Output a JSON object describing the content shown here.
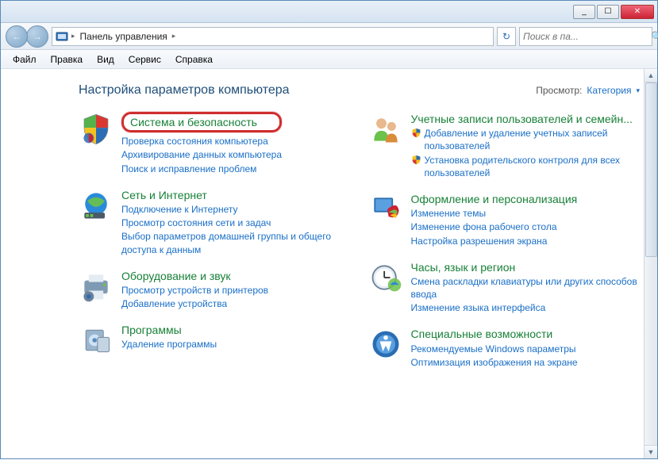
{
  "titlebar": {
    "min": "_",
    "max": "☐",
    "close": "✕"
  },
  "nav": {
    "back": "←",
    "fwd": "→",
    "breadcrumb": "Панель управления",
    "sep": "▸",
    "refresh": "↻",
    "search_placeholder": "Поиск в па...",
    "search_icon": "🔍"
  },
  "menu": {
    "file": "Файл",
    "edit": "Правка",
    "view": "Вид",
    "tools": "Сервис",
    "help": "Справка"
  },
  "page": {
    "heading": "Настройка параметров компьютера",
    "view_label": "Просмотр:",
    "view_value": "Категория",
    "view_chev": "▾"
  },
  "cats": {
    "system": {
      "title": "Система и безопасность",
      "l1": "Проверка состояния компьютера",
      "l2": "Архивирование данных компьютера",
      "l3": "Поиск и исправление проблем"
    },
    "network": {
      "title": "Сеть и Интернет",
      "l1": "Подключение к Интернету",
      "l2": "Просмотр состояния сети и задач",
      "l3": "Выбор параметров домашней группы и общего доступа к данным"
    },
    "hardware": {
      "title": "Оборудование и звук",
      "l1": "Просмотр устройств и принтеров",
      "l2": "Добавление устройства"
    },
    "programs": {
      "title": "Программы",
      "l1": "Удаление программы"
    },
    "users": {
      "title": "Учетные записи пользователей и семейн...",
      "l1": "Добавление и удаление учетных записей пользователей",
      "l2": "Установка родительского контроля для всех пользователей"
    },
    "appearance": {
      "title": "Оформление и персонализация",
      "l1": "Изменение темы",
      "l2": "Изменение фона рабочего стола",
      "l3": "Настройка разрешения экрана"
    },
    "clock": {
      "title": "Часы, язык и регион",
      "l1": "Смена раскладки клавиатуры или других способов ввода",
      "l2": "Изменение языка интерфейса"
    },
    "access": {
      "title": "Специальные возможности",
      "l1": "Рекомендуемые Windows параметры",
      "l2": "Оптимизация изображения на экране"
    }
  }
}
